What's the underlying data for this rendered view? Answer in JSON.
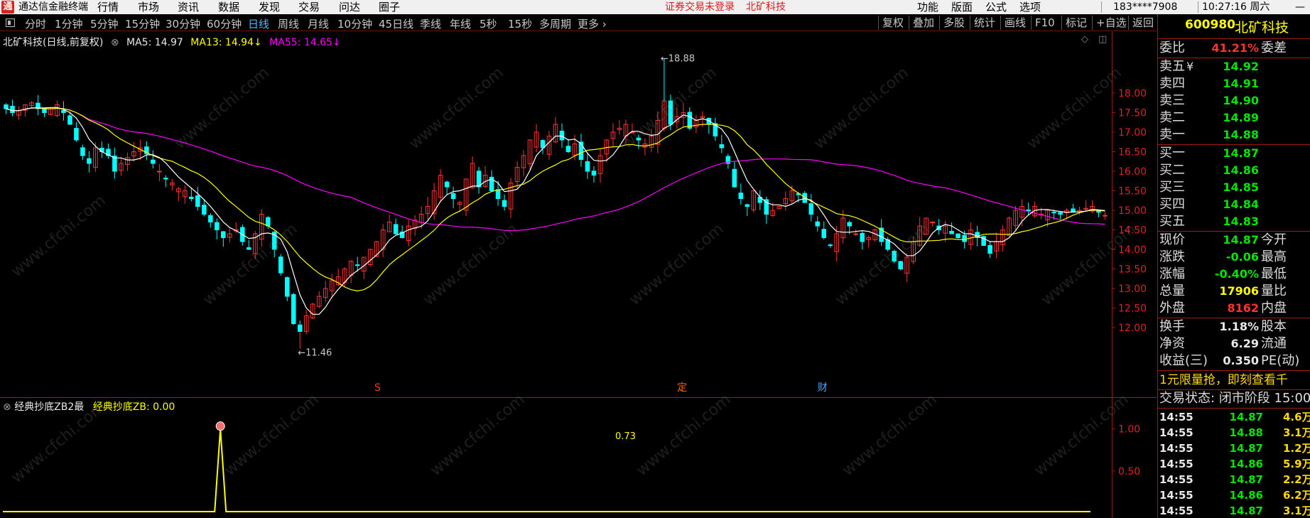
{
  "app": {
    "logo_char": "通",
    "title": "通达信金融终端",
    "menus": [
      "行情",
      "市场",
      "资讯",
      "数据",
      "发现",
      "交易",
      "问达",
      "圈子"
    ],
    "notice": "证券交易未登录",
    "notice_stock": "北矿科技",
    "right_menus": [
      "功能",
      "版面",
      "公式",
      "选项"
    ],
    "account": "183****7908",
    "clock": "10:27:16 周六",
    "minimize": "—"
  },
  "toolbar": {
    "periods": [
      "分时",
      "1分钟",
      "5分钟",
      "15分钟",
      "30分钟",
      "60分钟",
      "日线",
      "周线",
      "月线",
      "10分钟",
      "45日线",
      "季线",
      "年线",
      "5秒",
      "15秒",
      "多周期",
      "更多 ›"
    ],
    "active_period": "日线",
    "tools": [
      "复权",
      "叠加",
      "多股",
      "统计",
      "画线",
      "F10",
      "标记",
      "+自选",
      "返回"
    ]
  },
  "chart": {
    "legend_title": "北矿科技(日线,前复权)",
    "ma5": "MA5: 14.97",
    "ma13": "MA13: 14.94↓",
    "ma55": "MA55: 14.65↓",
    "high_label": "18.88",
    "low_label": "11.46",
    "markers": [
      "S",
      "定",
      "财"
    ],
    "colors": {
      "up": "#ff3232",
      "down": "#00ffff",
      "ma5": "#ffffff",
      "ma13": "#ffff00",
      "ma55": "#ff00ff"
    }
  },
  "chart_data": [
    {
      "type": "candlestick",
      "title": "北矿科技(日线,前复权)",
      "ylim": [
        11.2,
        19.2
      ],
      "yticks": [
        "18.00",
        "17.50",
        "17.00",
        "16.50",
        "16.00",
        "15.50",
        "15.00",
        "14.50",
        "14.00",
        "13.50",
        "13.00",
        "12.50",
        "12.00"
      ],
      "close": [
        17.6,
        17.5,
        17.55,
        17.7,
        17.75,
        17.6,
        17.5,
        17.6,
        17.7,
        17.5,
        17.2,
        16.8,
        16.4,
        16.2,
        16.6,
        16.5,
        16.4,
        16.0,
        16.2,
        16.35,
        16.5,
        16.6,
        16.45,
        16.2,
        16.0,
        15.8,
        15.7,
        15.55,
        15.5,
        15.3,
        15.1,
        14.9,
        14.7,
        14.5,
        14.3,
        14.4,
        14.5,
        14.2,
        14.0,
        14.4,
        14.9,
        14.6,
        14.0,
        13.4,
        12.8,
        12.1,
        11.9,
        12.3,
        12.6,
        12.8,
        13.0,
        13.2,
        13.3,
        13.5,
        13.7,
        13.6,
        13.8,
        14.0,
        14.2,
        14.5,
        14.7,
        14.4,
        14.3,
        14.6,
        14.75,
        14.9,
        15.1,
        15.5,
        15.9,
        15.6,
        15.3,
        15.2,
        15.8,
        16.2,
        15.6,
        15.9,
        15.5,
        15.3,
        15.1,
        15.7,
        16.1,
        16.4,
        16.8,
        17.0,
        16.6,
        16.9,
        17.2,
        16.8,
        16.5,
        16.7,
        16.3,
        16.0,
        15.9,
        16.4,
        16.8,
        17.0,
        17.1,
        17.2,
        17.0,
        16.8,
        16.7,
        16.9,
        17.3,
        17.8,
        17.2,
        17.4,
        17.5,
        17.1,
        17.3,
        17.4,
        17.2,
        16.9,
        16.6,
        16.2,
        15.6,
        15.3,
        15.1,
        15.5,
        15.2,
        14.9,
        15.0,
        15.1,
        15.3,
        15.5,
        15.4,
        15.2,
        14.9,
        14.6,
        14.3,
        14.1,
        14.4,
        14.8,
        14.6,
        14.4,
        14.2,
        14.3,
        14.5,
        14.2,
        14.0,
        13.7,
        13.5,
        13.8,
        14.2,
        14.6,
        14.8,
        14.7,
        14.5,
        14.6,
        14.4,
        14.3,
        14.2,
        14.5,
        14.3,
        14.1,
        13.9,
        14.2,
        14.5,
        14.8,
        15.0,
        15.1,
        15.0,
        15.1,
        14.9,
        15.0,
        14.95,
        14.9,
        15.0,
        14.95,
        15.0,
        15.05,
        15.1,
        14.95,
        14.87
      ],
      "ma5": 14.97,
      "ma13": 14.94,
      "ma55": 14.65,
      "high": 18.88,
      "low": 11.46
    },
    {
      "type": "line",
      "title": "经典抄底ZB2最",
      "series": [
        {
          "name": "经典抄底ZB",
          "last_value": 0.0
        }
      ],
      "yticks": [
        "1.00",
        "0.50"
      ],
      "ylim": [
        0,
        1.2
      ],
      "peak_value": 0.73
    }
  ],
  "indicator": {
    "name": "经典抄底ZB2最",
    "series_label": "经典抄底ZB: 0.00",
    "annotation": "0.73"
  },
  "watermark_text": "www.cfchi.com",
  "quote": {
    "code": "600980",
    "name": "北矿科技",
    "weibi_label": "委比",
    "weibi_value": "41.21%",
    "weicha_label": "委差",
    "asks": [
      {
        "label": "卖五",
        "price": "14.92"
      },
      {
        "label": "卖四",
        "price": "14.91"
      },
      {
        "label": "卖三",
        "price": "14.90"
      },
      {
        "label": "卖二",
        "price": "14.89"
      },
      {
        "label": "卖一",
        "price": "14.88"
      }
    ],
    "ask5_mark": "¥",
    "bids": [
      {
        "label": "买一",
        "price": "14.87"
      },
      {
        "label": "买二",
        "price": "14.86"
      },
      {
        "label": "买三",
        "price": "14.85"
      },
      {
        "label": "买四",
        "price": "14.84"
      },
      {
        "label": "买五",
        "price": "14.83"
      }
    ],
    "stats": [
      {
        "label": "现价",
        "value": "14.87",
        "label2": "今开",
        "color": "green"
      },
      {
        "label": "涨跌",
        "value": "-0.06",
        "label2": "最高",
        "color": "green"
      },
      {
        "label": "涨幅",
        "value": "-0.40%",
        "label2": "最低",
        "color": "green"
      },
      {
        "label": "总量",
        "value": "17906",
        "label2": "量比",
        "color": "yellow"
      },
      {
        "label": "外盘",
        "value": "8162",
        "label2": "内盘",
        "color": "red"
      }
    ],
    "stats2": [
      {
        "label": "换手",
        "value": "1.18%",
        "label2": "股本"
      },
      {
        "label": "净资",
        "value": "6.29",
        "label2": "流通"
      },
      {
        "label": "收益(三)",
        "value": "0.350",
        "label2": "PE(动)"
      }
    ],
    "promo": "1元限量抢，即刻查看千",
    "trade_status": "交易状态: 闭市阶段 15:00",
    "ticks": [
      {
        "time": "14:55",
        "price": "14.87",
        "vol": "4.6万",
        "color": "green"
      },
      {
        "time": "14:55",
        "price": "14.88",
        "vol": "3.1万",
        "color": "green"
      },
      {
        "time": "14:55",
        "price": "14.87",
        "vol": "1.2万",
        "color": "green"
      },
      {
        "time": "14:55",
        "price": "14.86",
        "vol": "5.9万",
        "color": "green"
      },
      {
        "time": "14:55",
        "price": "14.87",
        "vol": "2.2万",
        "color": "green"
      },
      {
        "time": "14:55",
        "price": "14.86",
        "vol": "6.2万",
        "color": "green"
      },
      {
        "time": "14:55",
        "price": "14.87",
        "vol": "3.1万",
        "color": "green"
      }
    ]
  }
}
